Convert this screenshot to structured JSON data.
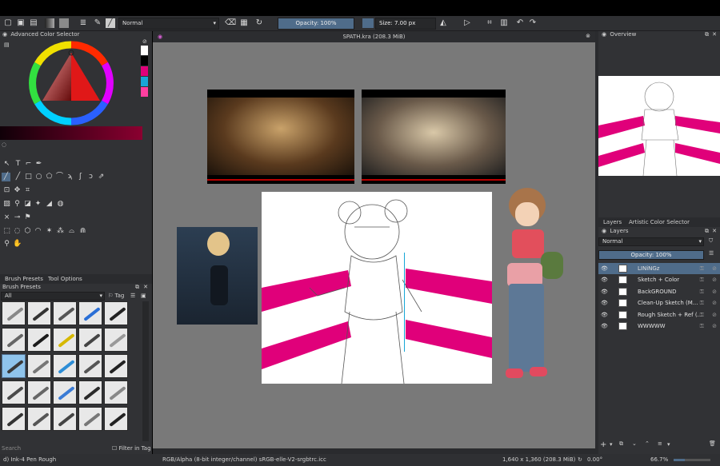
{
  "toolbar": {
    "blend_mode": "Normal",
    "opacity_label": "Opacity: 100%",
    "opacity_value": 1.0,
    "size_label": "Size: 7.00 px"
  },
  "color_selector": {
    "title": "Advanced Color Selector"
  },
  "document": {
    "title": "SPATH.kra (208.3 MiB)"
  },
  "overview": {
    "title": "Overview"
  },
  "left_tabs": {
    "brush_presets": "Brush Presets",
    "tool_options": "Tool Options"
  },
  "brush_presets": {
    "title": "Brush Presets",
    "filter": "All",
    "tag_label": "Tag",
    "search_placeholder": "Search",
    "filter_in_tag": "Filter in Tag"
  },
  "right_tabs": {
    "layers": "Layers",
    "artistic": "Artistic Color Selector"
  },
  "layers": {
    "title": "Layers",
    "blend_mode": "Normal",
    "opacity_label": "Opacity:  100%",
    "items": [
      {
        "name": "LINiNGz",
        "selected": true
      },
      {
        "name": "Sketch + Color",
        "selected": false
      },
      {
        "name": "BackGROUND",
        "selected": false
      },
      {
        "name": "Clean-Up Sketch (M...",
        "selected": false
      },
      {
        "name": "Rough Sketch + Ref (...",
        "selected": false
      },
      {
        "name": "WWWWW",
        "selected": false
      }
    ]
  },
  "status": {
    "brush": "d) Ink-4 Pen Rough",
    "color_model": "RGB/Alpha (8-bit integer/channel)  sRGB-elle-V2-srgbtrc.icc",
    "dimensions": "1,640 x 1,360 (208.3 MiB)",
    "rotation": "0.00°",
    "zoom": "66.7%"
  },
  "colors": {
    "accent": "#4f6c8a",
    "magenta": "#e0007a",
    "swatches": [
      "#ffffff",
      "#000000",
      "#e0007a",
      "#17a6d6",
      "#ff3fa0"
    ]
  }
}
